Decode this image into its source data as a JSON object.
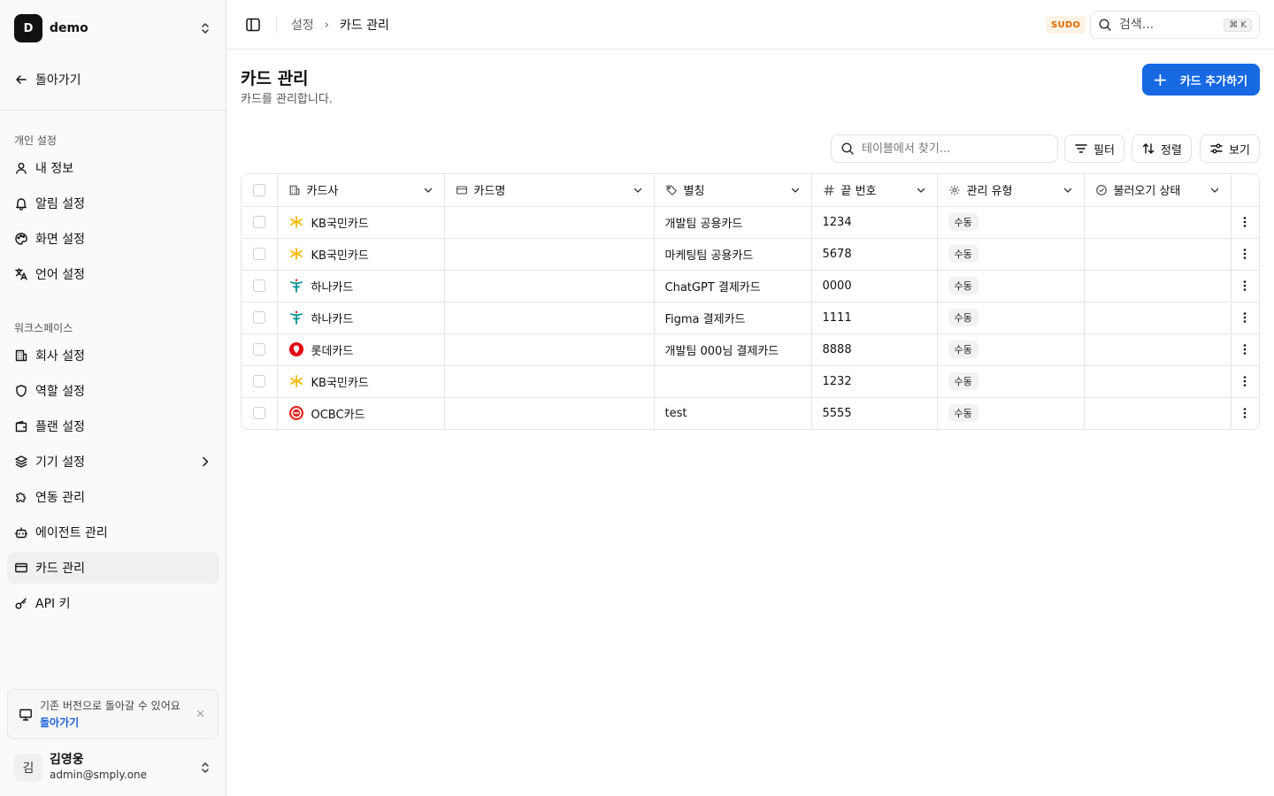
{
  "workspace": {
    "initial": "D",
    "name": "demo"
  },
  "sidebar": {
    "back_label": "돌아가기",
    "personal_group": "개인 설정",
    "personal_items": [
      {
        "label": "내 정보",
        "icon": "user-icon"
      },
      {
        "label": "알림 설정",
        "icon": "bell-icon"
      },
      {
        "label": "화면 설정",
        "icon": "palette-icon"
      },
      {
        "label": "언어 설정",
        "icon": "language-icon"
      }
    ],
    "workspace_group": "워크스페이스",
    "workspace_items": [
      {
        "label": "회사 설정",
        "icon": "building-icon"
      },
      {
        "label": "역할 설정",
        "icon": "shield-icon"
      },
      {
        "label": "플랜 설정",
        "icon": "wallet-icon"
      },
      {
        "label": "기기 설정",
        "icon": "layers-icon"
      },
      {
        "label": "연동 관리",
        "icon": "puzzle-icon"
      },
      {
        "label": "에이전트 관리",
        "icon": "bot-icon"
      },
      {
        "label": "카드 관리",
        "icon": "card-icon",
        "active": true
      },
      {
        "label": "API 키",
        "icon": "key-icon"
      }
    ],
    "notice": {
      "text": "기존 버전으로 돌아갈 수 있어요",
      "link": "돌아가기",
      "close": "×"
    },
    "user": {
      "initial": "김",
      "name": "김영웅",
      "email": "admin@smply.one"
    }
  },
  "header": {
    "breadcrumb": {
      "parent": "설정",
      "separator": "›",
      "current": "카드 관리"
    },
    "sudo_badge": "SUDO",
    "search_placeholder": "검색...",
    "search_shortcut": "⌘ K"
  },
  "page": {
    "title": "카드 관리",
    "subtitle": "카드를 관리합니다.",
    "add_button": "카드 추가하기",
    "add_button_icon": "+"
  },
  "toolbar": {
    "search_placeholder": "테이블에서 찾기...",
    "filter": "필터",
    "sort": "정렬",
    "view": "보기"
  },
  "table": {
    "columns": [
      "카드사",
      "카드명",
      "별칭",
      "끝 번호",
      "관리 유형",
      "불러오기 상태"
    ],
    "rows": [
      {
        "issuer": "KB국민카드",
        "logo": "kb",
        "card_name": "",
        "alias": "개발팀 공용카드",
        "last4": "1234",
        "type": "수동",
        "status": ""
      },
      {
        "issuer": "KB국민카드",
        "logo": "kb",
        "card_name": "",
        "alias": "마케팅팀 공용카드",
        "last4": "5678",
        "type": "수동",
        "status": ""
      },
      {
        "issuer": "하나카드",
        "logo": "hana",
        "card_name": "",
        "alias": "ChatGPT 결제카드",
        "last4": "0000",
        "type": "수동",
        "status": ""
      },
      {
        "issuer": "하나카드",
        "logo": "hana",
        "card_name": "",
        "alias": "Figma 결제카드",
        "last4": "1111",
        "type": "수동",
        "status": ""
      },
      {
        "issuer": "롯데카드",
        "logo": "lotte",
        "card_name": "",
        "alias": "개발팀 000님 결제카드",
        "last4": "8888",
        "type": "수동",
        "status": ""
      },
      {
        "issuer": "KB국민카드",
        "logo": "kb",
        "card_name": "",
        "alias": "",
        "last4": "1232",
        "type": "수동",
        "status": ""
      },
      {
        "issuer": "OCBC카드",
        "logo": "ocbc",
        "card_name": "",
        "alias": "test",
        "last4": "5555",
        "type": "수동",
        "status": ""
      }
    ]
  },
  "colors": {
    "primary": "#1668e3",
    "sudo_text": "#e06a00",
    "sudo_bg": "#fff3e6",
    "kb": "#f5b700",
    "hana": "#00918e",
    "lotte": "#e60012",
    "ocbc": "#e1251b"
  }
}
